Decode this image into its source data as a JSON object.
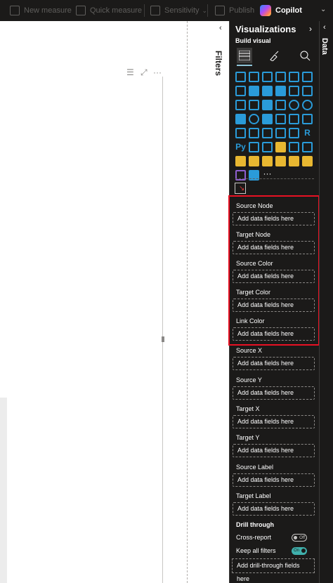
{
  "ribbon": {
    "new_measure": "New measure",
    "quick_measure": "Quick measure",
    "sensitivity": "Sensitivity",
    "publish": "Publish",
    "copilot": "Copilot"
  },
  "filters": {
    "label": "Filters",
    "chevron": "‹"
  },
  "visualizations": {
    "title": "Visualizations",
    "chevron": "›",
    "subtitle": "Build visual",
    "r_visual": "R",
    "python_visual": "Py",
    "more": "···",
    "wells": [
      {
        "label": "Source Node",
        "placeholder": "Add data fields here"
      },
      {
        "label": "Target Node",
        "placeholder": "Add data fields here"
      },
      {
        "label": "Source Color",
        "placeholder": "Add data fields here"
      },
      {
        "label": "Target Color",
        "placeholder": "Add data fields here"
      },
      {
        "label": "Link Color",
        "placeholder": "Add data fields here"
      },
      {
        "label": "Source X",
        "placeholder": "Add data fields here"
      },
      {
        "label": "Source Y",
        "placeholder": "Add data fields here"
      },
      {
        "label": "Target X",
        "placeholder": "Add data fields here"
      },
      {
        "label": "Target Y",
        "placeholder": "Add data fields here"
      },
      {
        "label": "Source Label",
        "placeholder": "Add data fields here"
      },
      {
        "label": "Target Label",
        "placeholder": "Add data fields here"
      }
    ],
    "drill_through": {
      "title": "Drill through",
      "cross_report": "Cross-report",
      "cross_report_state": "Off",
      "keep_all_filters": "Keep all filters",
      "keep_all_filters_state": "On",
      "add_fields": "Add drill-through fields here"
    }
  },
  "data_pane": {
    "label": "Data",
    "chevron": "‹"
  },
  "colors": {
    "highlight": "#e81123",
    "pane_bg": "#1b1a19",
    "accent": "#2a9bd9"
  }
}
